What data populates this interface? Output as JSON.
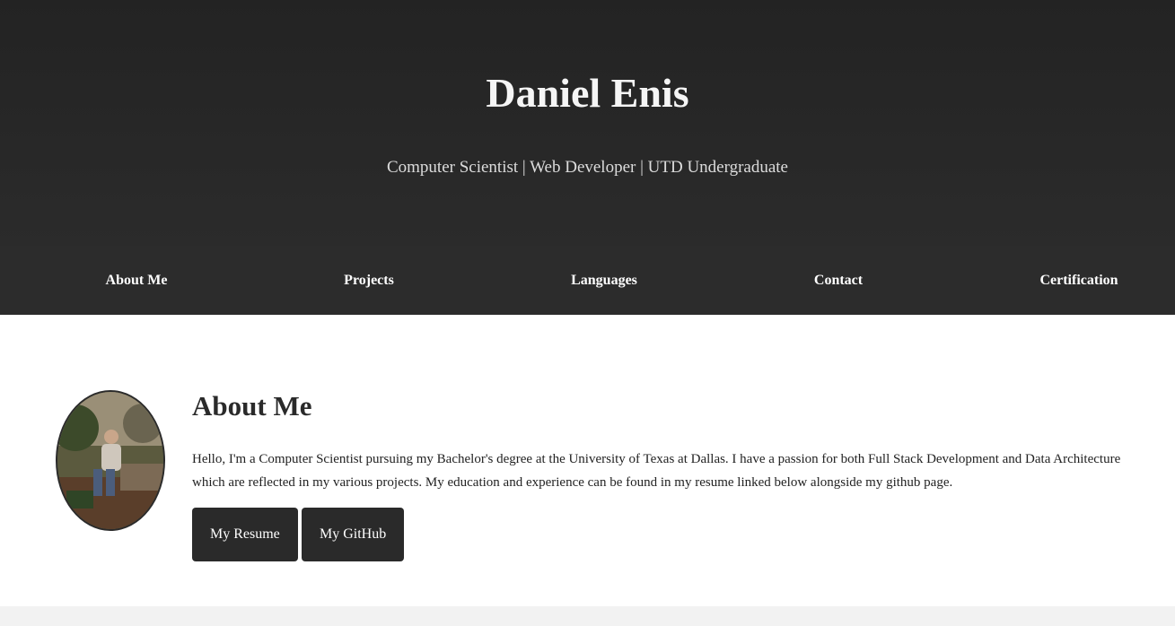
{
  "header": {
    "name": "Daniel Enis",
    "tagline": "Computer Scientist | Web Developer | UTD Undergraduate"
  },
  "nav": {
    "items": [
      "About Me",
      "Projects",
      "Languages",
      "Contact",
      "Certification"
    ]
  },
  "about": {
    "heading": "About Me",
    "body": "Hello, I'm a Computer Scientist pursuing my Bachelor's degree at the University of Texas at Dallas. I have a passion for both Full Stack Development and Data Architecture which are reflected in my various projects. My education and experience can be found in my resume linked below alongside my github page.",
    "buttons": [
      "My Resume",
      "My GitHub"
    ]
  },
  "colors": {
    "header_bg": "#242424",
    "nav_bg": "#2c2c2c",
    "button_bg": "#2a2a2a"
  }
}
